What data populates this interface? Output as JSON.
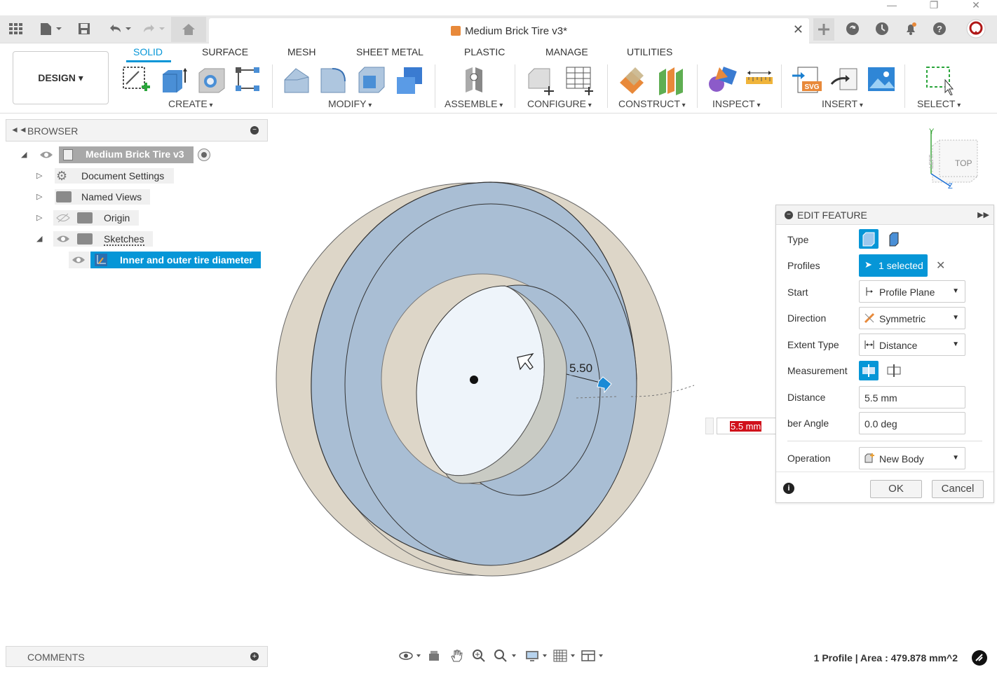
{
  "window": {
    "document_title": "Medium Brick Tire v3*"
  },
  "ribbon": {
    "workspace": "DESIGN ▾",
    "tabs": [
      "SOLID",
      "SURFACE",
      "MESH",
      "SHEET METAL",
      "PLASTIC",
      "MANAGE",
      "UTILITIES"
    ],
    "active_tab": "SOLID",
    "groups": [
      "CREATE",
      "MODIFY",
      "ASSEMBLE",
      "CONFIGURE",
      "CONSTRUCT",
      "INSPECT",
      "INSERT",
      "SELECT"
    ]
  },
  "browser": {
    "title": "BROWSER",
    "root": "Medium Brick Tire v3",
    "items": [
      "Document Settings",
      "Named Views",
      "Origin",
      "Sketches"
    ],
    "sketch": "Inner and outer tire diameter"
  },
  "comments": {
    "title": "COMMENTS"
  },
  "viewcube": {
    "face_label": "TOP",
    "axis_y": "Y",
    "axis_z": "Z"
  },
  "viewport": {
    "dimension_label": "5.50",
    "distance_input_value": "5.5 mm"
  },
  "edit_feature": {
    "title": "EDIT FEATURE",
    "type_label": "Type",
    "profiles_label": "Profiles",
    "profiles_value": "1 selected",
    "start_label": "Start",
    "start_value": "Profile Plane",
    "direction_label": "Direction",
    "direction_value": "Symmetric",
    "extent_type_label": "Extent Type",
    "extent_type_value": "Distance",
    "measurement_label": "Measurement",
    "distance_label": "Distance",
    "distance_value": "5.5 mm",
    "taper_label": "ber Angle",
    "taper_value": "0.0 deg",
    "operation_label": "Operation",
    "operation_value": "New Body",
    "ok_label": "OK",
    "cancel_label": "Cancel"
  },
  "status": {
    "text": "1 Profile | Area : 479.878 mm^2"
  },
  "colors": {
    "accent": "#0696d7",
    "body_blue": "#a9bed4",
    "body_tan": "#ddd6c8",
    "error_red": "#d0101a"
  }
}
